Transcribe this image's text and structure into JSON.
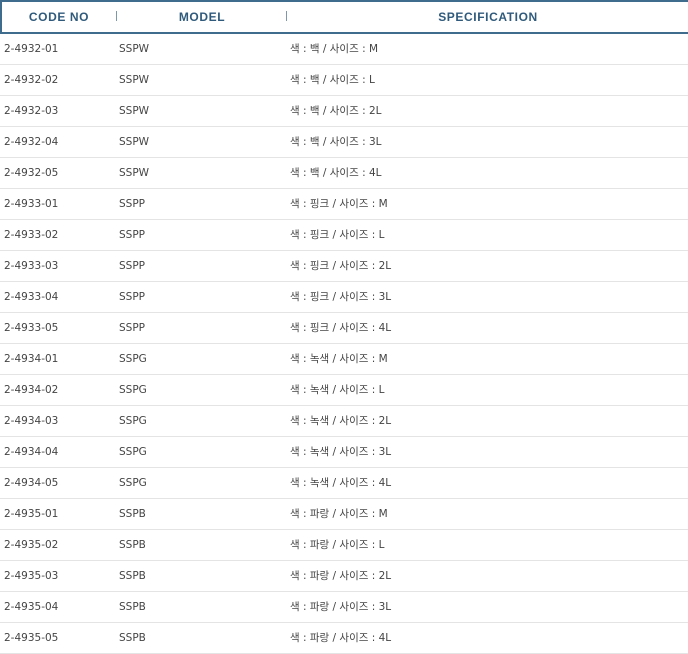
{
  "header": {
    "code": "CODE NO",
    "model": "MODEL",
    "spec": "SPECIFICATION"
  },
  "rows": [
    {
      "code": "2-4932-01",
      "model": "SSPW",
      "spec": "색 : 백 / 사이즈 : M"
    },
    {
      "code": "2-4932-02",
      "model": "SSPW",
      "spec": "색 : 백 / 사이즈 : L"
    },
    {
      "code": "2-4932-03",
      "model": "SSPW",
      "spec": "색 : 백 / 사이즈 : 2L"
    },
    {
      "code": "2-4932-04",
      "model": "SSPW",
      "spec": "색 : 백 / 사이즈 : 3L"
    },
    {
      "code": "2-4932-05",
      "model": "SSPW",
      "spec": "색 : 백 / 사이즈 : 4L"
    },
    {
      "code": "2-4933-01",
      "model": "SSPP",
      "spec": "색 : 핑크 / 사이즈 : M"
    },
    {
      "code": "2-4933-02",
      "model": "SSPP",
      "spec": "색 : 핑크 / 사이즈 : L"
    },
    {
      "code": "2-4933-03",
      "model": "SSPP",
      "spec": "색 : 핑크 / 사이즈 : 2L"
    },
    {
      "code": "2-4933-04",
      "model": "SSPP",
      "spec": "색 : 핑크 / 사이즈 : 3L"
    },
    {
      "code": "2-4933-05",
      "model": "SSPP",
      "spec": "색 : 핑크 / 사이즈 : 4L"
    },
    {
      "code": "2-4934-01",
      "model": "SSPG",
      "spec": "색 : 녹색 / 사이즈 : M"
    },
    {
      "code": "2-4934-02",
      "model": "SSPG",
      "spec": "색 : 녹색 / 사이즈 : L"
    },
    {
      "code": "2-4934-03",
      "model": "SSPG",
      "spec": "색 : 녹색 / 사이즈 : 2L"
    },
    {
      "code": "2-4934-04",
      "model": "SSPG",
      "spec": "색 : 녹색 / 사이즈 : 3L"
    },
    {
      "code": "2-4934-05",
      "model": "SSPG",
      "spec": "색 : 녹색 / 사이즈 : 4L"
    },
    {
      "code": "2-4935-01",
      "model": "SSPB",
      "spec": "색 : 파랑 / 사이즈 : M"
    },
    {
      "code": "2-4935-02",
      "model": "SSPB",
      "spec": "색 : 파랑 / 사이즈 : L"
    },
    {
      "code": "2-4935-03",
      "model": "SSPB",
      "spec": "색 : 파랑 / 사이즈 : 2L"
    },
    {
      "code": "2-4935-04",
      "model": "SSPB",
      "spec": "색 : 파랑 / 사이즈 : 3L"
    },
    {
      "code": "2-4935-05",
      "model": "SSPB",
      "spec": "색 : 파랑 / 사이즈 : 4L"
    }
  ]
}
